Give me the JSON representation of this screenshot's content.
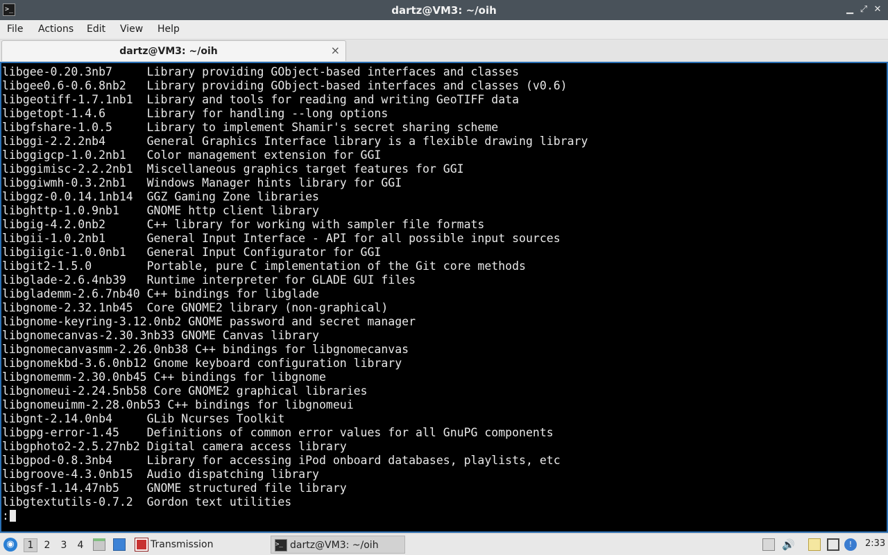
{
  "window": {
    "title": "dartz@VM3: ~/oih",
    "minimize_glyph": "▁",
    "maximize_glyph": "⤢",
    "close_glyph": "✕"
  },
  "menu": [
    "File",
    "Actions",
    "Edit",
    "View",
    "Help"
  ],
  "tab": {
    "label": "dartz@VM3: ~/oih",
    "close_glyph": "×"
  },
  "terminal": {
    "lines": [
      "libgee-0.20.3nb7     Library providing GObject-based interfaces and classes",
      "libgee0.6-0.6.8nb2   Library providing GObject-based interfaces and classes (v0.6)",
      "libgeotiff-1.7.1nb1  Library and tools for reading and writing GeoTIFF data",
      "libgetopt-1.4.6      Library for handling --long options",
      "libgfshare-1.0.5     Library to implement Shamir's secret sharing scheme",
      "libggi-2.2.2nb4      General Graphics Interface library is a flexible drawing library",
      "libggigcp-1.0.2nb1   Color management extension for GGI",
      "libggimisc-2.2.2nb1  Miscellaneous graphics target features for GGI",
      "libggiwmh-0.3.2nb1   Windows Manager hints library for GGI",
      "libggz-0.0.14.1nb14  GGZ Gaming Zone libraries",
      "libghttp-1.0.9nb1    GNOME http client library",
      "libgig-4.2.0nb2      C++ library for working with sampler file formats",
      "libgii-1.0.2nb1      General Input Interface - API for all possible input sources",
      "libgiigic-1.0.0nb1   General Input Configurator for GGI",
      "libgit2-1.5.0        Portable, pure C implementation of the Git core methods",
      "libglade-2.6.4nb39   Runtime interpreter for GLADE GUI files",
      "libglademm-2.6.7nb40 C++ bindings for libglade",
      "libgnome-2.32.1nb45  Core GNOME2 library (non-graphical)",
      "libgnome-keyring-3.12.0nb2 GNOME password and secret manager",
      "libgnomecanvas-2.30.3nb33 GNOME Canvas library",
      "libgnomecanvasmm-2.26.0nb38 C++ bindings for libgnomecanvas",
      "libgnomekbd-3.6.0nb12 Gnome keyboard configuration library",
      "libgnomemm-2.30.0nb45 C++ bindings for libgnome",
      "libgnomeui-2.24.5nb58 Core GNOME2 graphical libraries",
      "libgnomeuimm-2.28.0nb53 C++ bindings for libgnomeui",
      "libgnt-2.14.0nb4     GLib Ncurses Toolkit",
      "libgpg-error-1.45    Definitions of common error values for all GnuPG components",
      "libgphoto2-2.5.27nb2 Digital camera access library",
      "libgpod-0.8.3nb4     Library for accessing iPod onboard databases, playlists, etc",
      "libgroove-4.3.0nb15  Audio dispatching library",
      "libgsf-1.14.47nb5    GNOME structured file library",
      "libgtextutils-0.7.2  Gordon text utilities"
    ],
    "prompt": ":"
  },
  "taskbar": {
    "desktops": [
      "1",
      "2",
      "3",
      "4"
    ],
    "active_desktop": "1",
    "tasks": [
      {
        "label": "Transmission",
        "icon": "transmission-icon"
      },
      {
        "label": "dartz@VM3: ~/oih",
        "icon": "terminal-icon"
      }
    ],
    "clock": "2:33"
  },
  "colors": {
    "titlebar": "#49525a",
    "terminal_bg": "#000000",
    "terminal_fg": "#e8e8e8",
    "terminal_border": "#2a6fb4",
    "taskbar": "#e8e8e8"
  }
}
